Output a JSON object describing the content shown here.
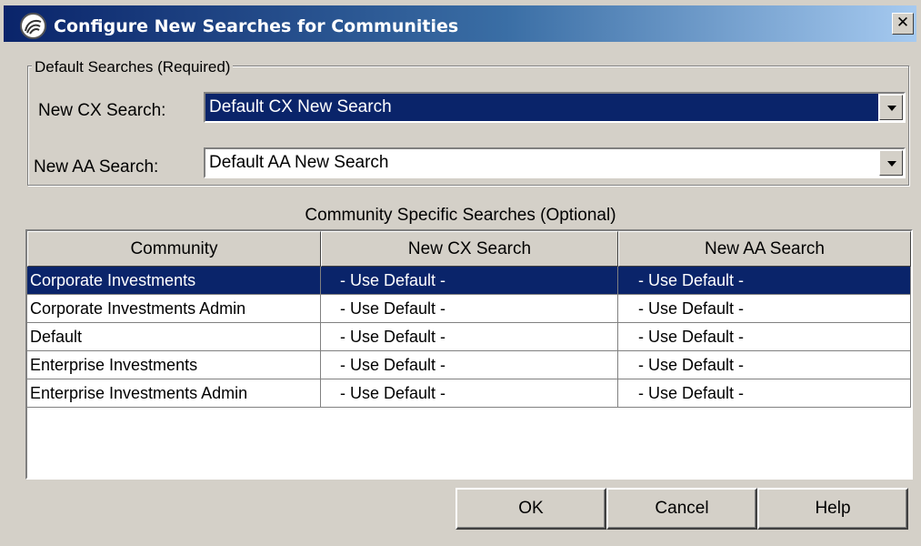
{
  "window": {
    "title": "Configure New Searches for Communities",
    "close_label": "✕"
  },
  "defaults": {
    "group_label": "Default Searches (Required)",
    "cx_label": "New CX Search:",
    "cx_value": "Default CX New Search",
    "aa_label": "New AA Search:",
    "aa_value": "Default AA New Search"
  },
  "table": {
    "caption": "Community Specific Searches (Optional)",
    "columns": [
      "Community",
      "New CX Search",
      "New AA Search"
    ],
    "rows": [
      [
        "Corporate Investments",
        "- Use Default -",
        "- Use Default -"
      ],
      [
        "Corporate Investments Admin",
        "- Use Default -",
        "- Use Default -"
      ],
      [
        "Default",
        "- Use Default -",
        "- Use Default -"
      ],
      [
        "Enterprise Investments",
        "- Use Default -",
        "- Use Default -"
      ],
      [
        "Enterprise Investments Admin",
        "- Use Default -",
        "- Use Default -"
      ]
    ],
    "selected_row": 0
  },
  "buttons": {
    "ok": "OK",
    "cancel": "Cancel",
    "help": "Help"
  },
  "icons": {
    "app": "app-logo-icon",
    "close": "close-icon",
    "dropdown": "chevron-down-icon"
  },
  "colors": {
    "selection": "#0a246a",
    "dialog_bg": "#d4d0c8"
  }
}
